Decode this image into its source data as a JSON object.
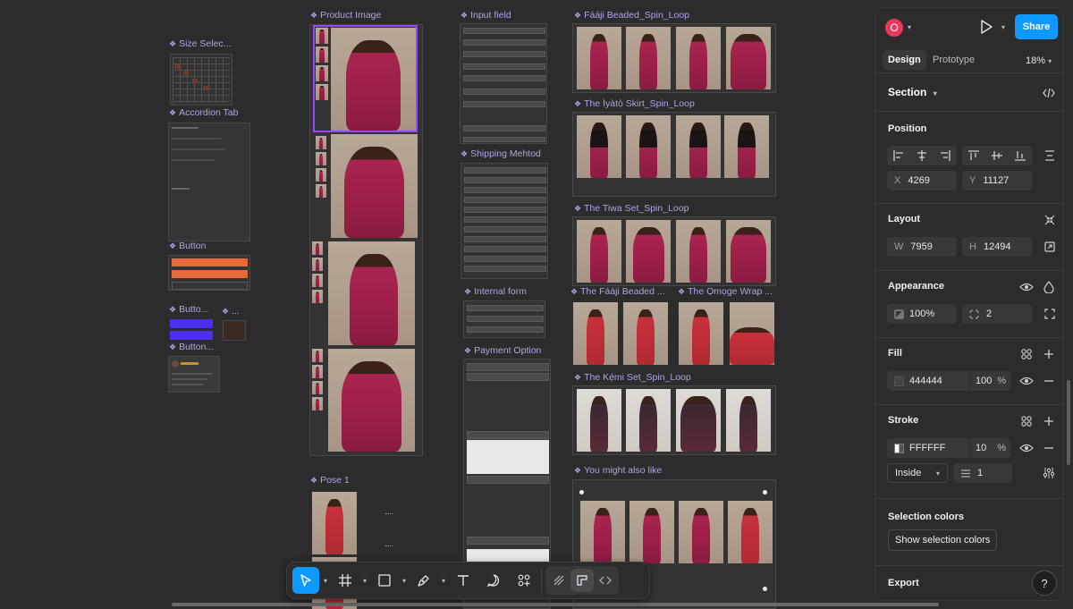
{
  "canvas": {
    "labels": {
      "size_selector": "Size Selec...",
      "accordion_tab": "Accordion Tab",
      "button": "Button",
      "button_variant_1": "Butto...",
      "button_variant_2": "Button...",
      "button_dots": "...",
      "product_image": "Product Image",
      "pose_1": "Pose 1",
      "input_field": "Input field",
      "shipping_method": "Shipping Mehtod",
      "internal_form": "Internal form",
      "payment_option": "Payment Option",
      "faaji_beaded_spin": "Fááji Beaded_Spin_Loop",
      "iyato_skirt_spin": "The Ìyàtọ̀ Skirt_Spin_Loop",
      "tiwa_set_spin": "The Tiwa Set_Spin_Loop",
      "faaji_beaded_short": "The Fááji Beaded ...",
      "omoge_wrap_short": "The Ọmọge Wrap ...",
      "kemi_set_spin": "The Kẹ́mi Set_Spin_Loop",
      "you_might_also_like": "You might also like"
    }
  },
  "toolbar": {
    "tools": [
      {
        "name": "move-tool",
        "icon": "cursor-icon",
        "active": true
      },
      {
        "name": "frame-tool",
        "icon": "frame-icon"
      },
      {
        "name": "shape-tool",
        "icon": "rectangle-icon"
      },
      {
        "name": "pen-tool",
        "icon": "pen-icon"
      },
      {
        "name": "text-tool",
        "icon": "text-icon"
      },
      {
        "name": "comment-tool",
        "icon": "comment-icon"
      },
      {
        "name": "actions-tool",
        "icon": "actions-icon"
      }
    ],
    "modes": [
      "draw-mode-icon",
      "design-mode-icon",
      "dev-mode-icon"
    ]
  },
  "panel": {
    "avatar_letter": "O",
    "share_label": "Share",
    "tabs": {
      "design": "Design",
      "prototype": "Prototype"
    },
    "zoom": "18%",
    "section_title": "Section",
    "position": {
      "title": "Position",
      "x_label": "X",
      "x": "4269",
      "y_label": "Y",
      "y": "11127"
    },
    "layout": {
      "title": "Layout",
      "w_label": "W",
      "w": "7959",
      "h_label": "H",
      "h": "12494"
    },
    "appearance": {
      "title": "Appearance",
      "opacity": "100%",
      "radius": "2"
    },
    "fill": {
      "title": "Fill",
      "hex": "444444",
      "opacity": "100",
      "percent": "%",
      "color": "#444444"
    },
    "stroke": {
      "title": "Stroke",
      "hex": "FFFFFF",
      "opacity": "10",
      "percent": "%",
      "position": "Inside",
      "weight": "1",
      "color": "#FFFFFF"
    },
    "selection_colors": {
      "title": "Selection colors",
      "button": "Show selection colors"
    },
    "export": {
      "title": "Export"
    },
    "help": "?"
  },
  "colors": {
    "accent": "#0d99ff",
    "component": "#a9a6e8",
    "selection": "#9747ff",
    "avatar": "#e8395c"
  }
}
